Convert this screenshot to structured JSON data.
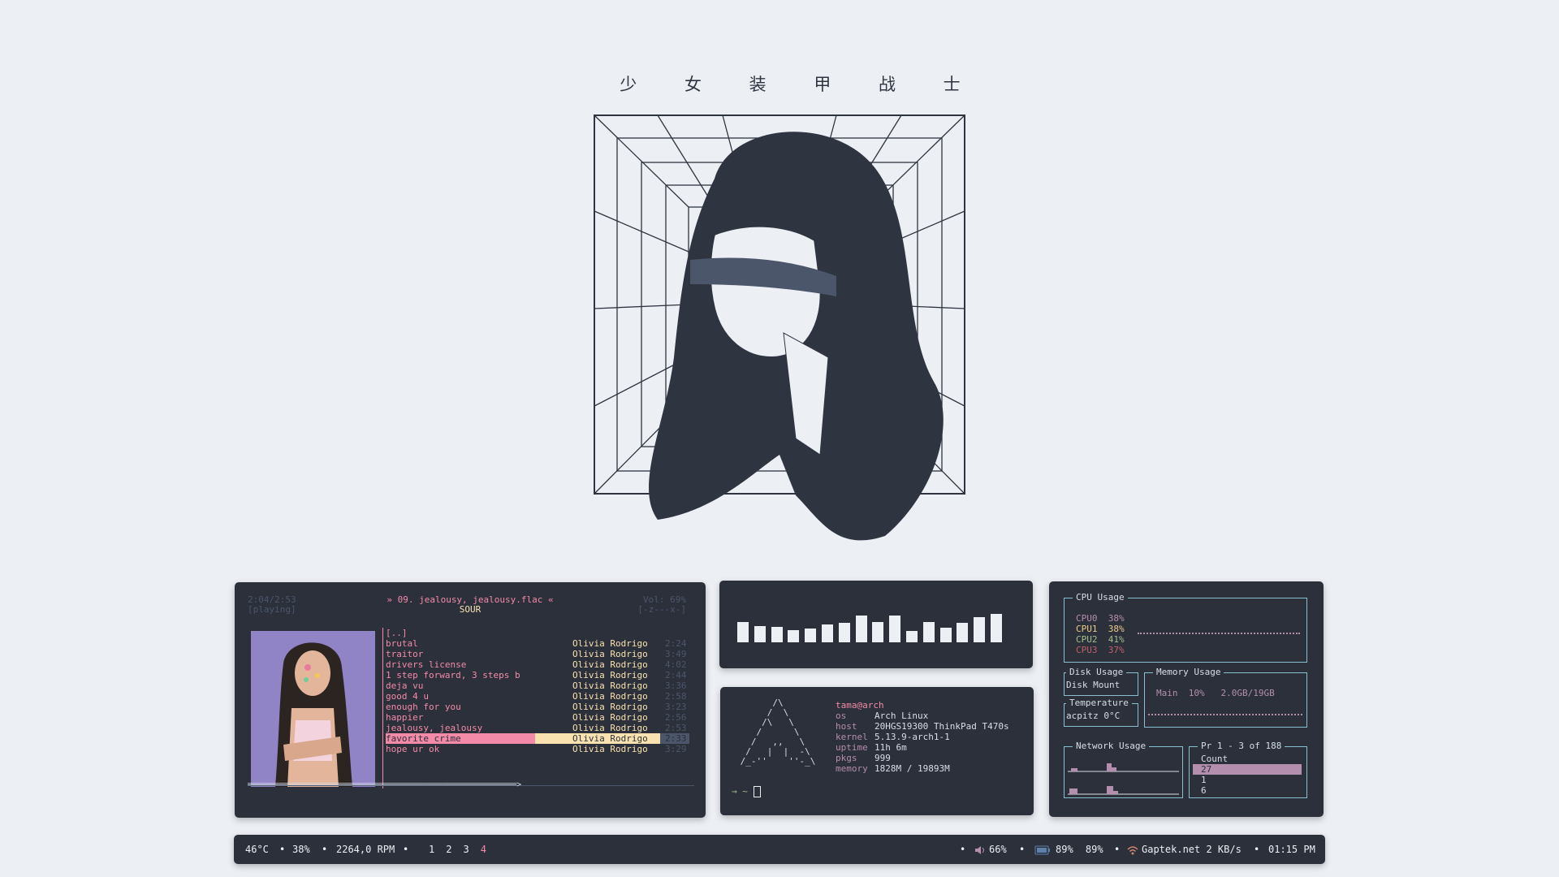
{
  "title": "少 女 装 甲 战 士",
  "player": {
    "time": "2:04/2:53",
    "state": "[playing]",
    "now_playing": "» 09. jealousy, jealousy.flac «",
    "album": "SOUR",
    "volume": "Vol: 69%",
    "flags": "[-z---x-]",
    "parent": "[..]",
    "progress_bar": "═══════════════════════════════════════════════════════>",
    "tracks": [
      {
        "title": "brutal",
        "artist": "Olivia Rodrigo",
        "duration": "2:24"
      },
      {
        "title": "traitor",
        "artist": "Olivia Rodrigo",
        "duration": "3:49"
      },
      {
        "title": "drivers license",
        "artist": "Olivia Rodrigo",
        "duration": "4:02"
      },
      {
        "title": "1 step forward, 3 steps b",
        "artist": "Olivia Rodrigo",
        "duration": "2:44"
      },
      {
        "title": "deja vu",
        "artist": "Olivia Rodrigo",
        "duration": "3:36"
      },
      {
        "title": "good 4 u",
        "artist": "Olivia Rodrigo",
        "duration": "2:58"
      },
      {
        "title": "enough for you",
        "artist": "Olivia Rodrigo",
        "duration": "3:23"
      },
      {
        "title": "happier",
        "artist": "Olivia Rodrigo",
        "duration": "2:56"
      },
      {
        "title": "jealousy, jealousy",
        "artist": "Olivia Rodrigo",
        "duration": "2:53"
      },
      {
        "title": "favorite crime",
        "artist": "Olivia Rodrigo",
        "duration": "2:33"
      },
      {
        "title": "hope ur ok",
        "artist": "Olivia Rodrigo",
        "duration": "3:29"
      }
    ]
  },
  "visualizer": {
    "levels": [
      0.62,
      0.5,
      0.47,
      0.38,
      0.42,
      0.55,
      0.6,
      0.82,
      0.62,
      0.82,
      0.35,
      0.62,
      0.45,
      0.6,
      0.78,
      0.88
    ]
  },
  "fetch": {
    "logo": "       /\\\n      /  \\\n     /\\   \\\n    /      \\\n   /   ,,   \\\n  /   |  |  -\\\n /_-''    ''-_\\",
    "user": "tama@arch",
    "rows": [
      {
        "key": "os",
        "value": "Arch Linux"
      },
      {
        "key": "host",
        "value": "20HGS19300 ThinkPad T470s"
      },
      {
        "key": "kernel",
        "value": "5.13.9-arch1-1"
      },
      {
        "key": "uptime",
        "value": "11h 6m"
      },
      {
        "key": "pkgs",
        "value": "999"
      },
      {
        "key": "memory",
        "value": "1828M / 19893M"
      }
    ],
    "prompt": "→  ~ "
  },
  "monitor": {
    "cpu_title": "CPU Usage",
    "cpus": [
      {
        "name": "CPU0",
        "value": "38%",
        "color": "#b48ead"
      },
      {
        "name": "CPU1",
        "value": "38%",
        "color": "#ebcb8b"
      },
      {
        "name": "CPU2",
        "value": "41%",
        "color": "#a3be8c"
      },
      {
        "name": "CPU3",
        "value": "37%",
        "color": "#bf616a"
      }
    ],
    "disk_title": "Disk Usage",
    "disk_cols": "Disk  Mount",
    "mem_title": "Memory Usage",
    "mem_row": "Main  10%   2.0GB/19GB",
    "temp_title": "Temperature",
    "temp_row": "acpitz   0°C",
    "net_title": "Network Usage",
    "proc_title": "Pr 1 - 3 of 188",
    "proc_col": "Count",
    "proc_rows": [
      "27",
      "1",
      "6"
    ]
  },
  "statusbar": {
    "temp": "46°C",
    "cpu": "38%",
    "fan": "2264,0 RPM",
    "workspaces": [
      "1",
      "2",
      "3",
      "4"
    ],
    "active_workspace": "4",
    "volume": "66%",
    "battery1": "89%",
    "battery2": "89%",
    "network": "Gaptek.net 2 KB/s",
    "clock": "01:15 PM"
  },
  "colors": {
    "background": "#eceff4",
    "panel": "#2b303b",
    "accent_pink": "#f38ba8",
    "accent_yellow": "#f9e2af",
    "accent_purple": "#b48ead",
    "border_cyan": "#88c0d0"
  }
}
